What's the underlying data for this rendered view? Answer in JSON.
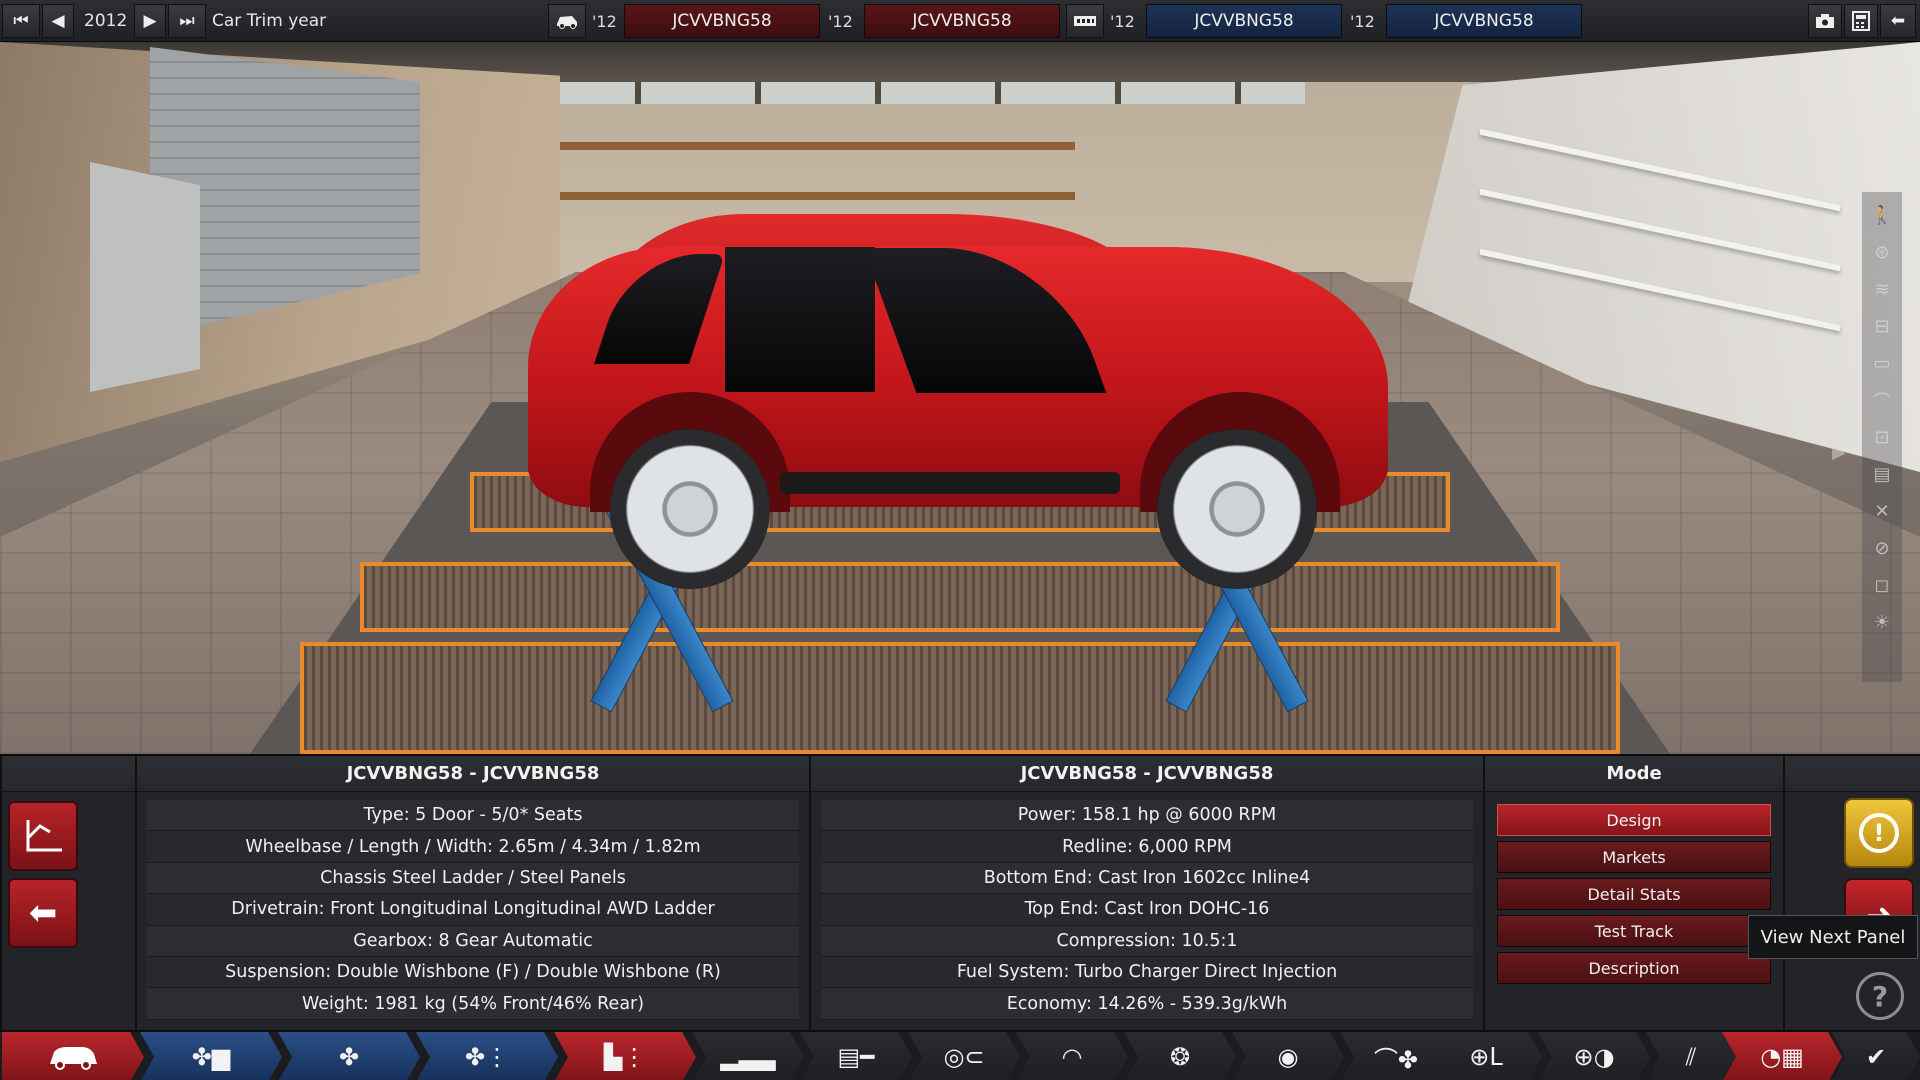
{
  "topbar": {
    "year_label": "2012",
    "trim_year_label": "Car Trim year",
    "trims": [
      {
        "year": "'12",
        "name": "JCVVBNG58"
      },
      {
        "year": "'12",
        "name": "JCVVBNG58"
      },
      {
        "year": "'12",
        "name": "JCVVBNG58"
      },
      {
        "year": "'12",
        "name": "JCVVBNG58"
      }
    ]
  },
  "left_panel": {
    "title": "JCVVBNG58 - JCVVBNG58",
    "rows": [
      "Type: 5 Door - 5/0* Seats",
      "Wheelbase / Length / Width: 2.65m / 4.34m / 1.82m",
      "Chassis Steel Ladder / Steel Panels",
      "Drivetrain: Front Longitudinal Longitudinal AWD Ladder",
      "Gearbox: 8 Gear Automatic",
      "Suspension: Double Wishbone (F) / Double Wishbone (R)",
      "Weight: 1981 kg (54% Front/46% Rear)"
    ]
  },
  "right_panel": {
    "title": "JCVVBNG58 - JCVVBNG58",
    "rows": [
      "Power: 158.1 hp @ 6000 RPM",
      "Redline:  6,000 RPM",
      "Bottom End: Cast Iron 1602cc Inline4",
      "Top End: Cast Iron DOHC-16",
      "Compression: 10.5:1",
      "Fuel System: Turbo Charger Direct Injection",
      "Economy: 14.26% - 539.3g/kWh"
    ]
  },
  "mode": {
    "title": "Mode",
    "buttons": [
      "Design",
      "Markets",
      "Detail Stats",
      "Test Track",
      "Description"
    ],
    "active": "Design"
  },
  "tooltip": "View Next Panel",
  "icons": {
    "rewind": "⏮",
    "prev": "◀",
    "next": "▶",
    "fastforward": "⏭",
    "camera": "📷",
    "calculator": "▦",
    "back": "⬅",
    "warning": "!",
    "help": "?",
    "check": "✔"
  },
  "colors": {
    "accent_red": "#b9262c",
    "accent_blue": "#2a4f86",
    "warning_yellow": "#f0c63a",
    "car_red": "#d61f22"
  }
}
